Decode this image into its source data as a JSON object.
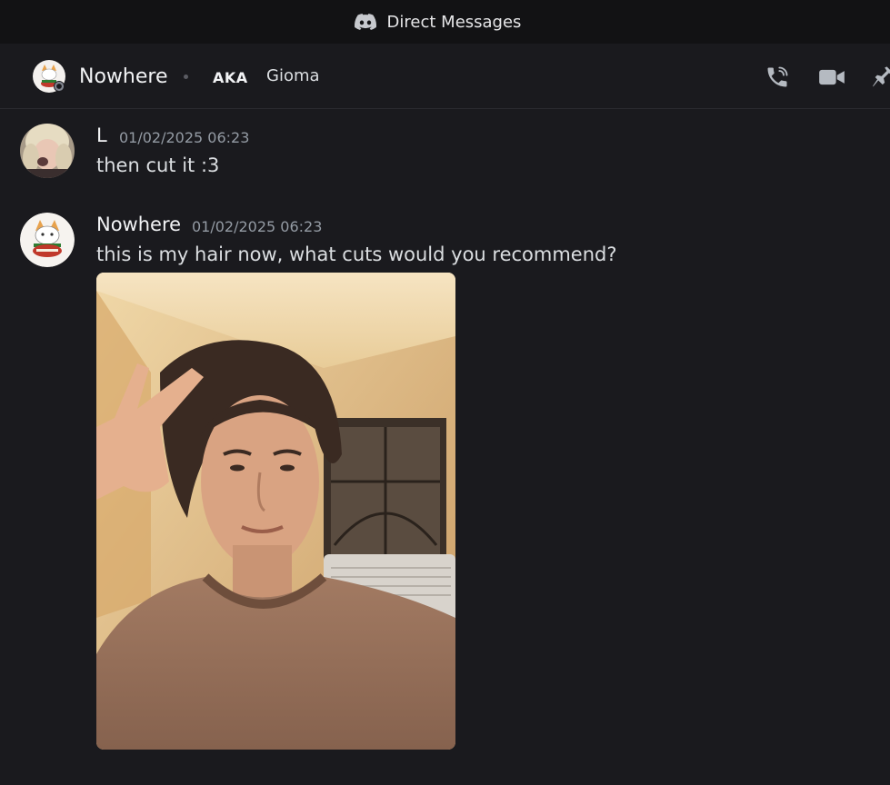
{
  "titlebar": {
    "title": "Direct Messages",
    "icon": "discord-icon"
  },
  "header": {
    "name": "Nowhere",
    "aka_label": "AKA",
    "alias": "Gioma",
    "status": "offline",
    "actions": [
      "voice-call-icon",
      "video-call-icon",
      "pin-icon"
    ]
  },
  "messages": [
    {
      "author": "L",
      "timestamp": "01/02/2025 06:23",
      "text": "then cut it :3"
    },
    {
      "author": "Nowhere",
      "timestamp": "01/02/2025 06:23",
      "text": "this is my hair now, what cuts would you recommend?",
      "attachment": "selfie-image"
    }
  ],
  "colors": {
    "background": "#1a1a1e",
    "titlebar": "#121214",
    "text": "#dbdee1",
    "muted": "#949ba4",
    "icon": "#b5bac1"
  }
}
